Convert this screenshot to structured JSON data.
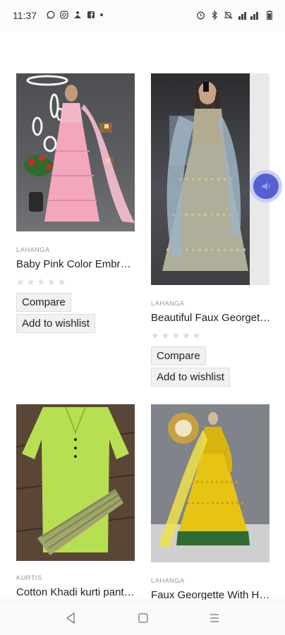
{
  "status_bar": {
    "time": "11:37",
    "left_icons": [
      "whatsapp-icon",
      "instagram-icon",
      "share-icon",
      "facebook-icon",
      "dot-icon"
    ],
    "right_icons": [
      "alarm-icon",
      "bluetooth-icon",
      "mute-icon",
      "signal-icon",
      "battery-icon"
    ]
  },
  "products": [
    {
      "category": "LAHANGA",
      "name": "Baby Pink Color Embroidered Lehenga",
      "compare_label": "Compare",
      "wishlist_label": "Add to wishlist",
      "rating": 0,
      "image": "pink-lehenga-image"
    },
    {
      "category": "LAHANGA",
      "name": "Beautiful Faux Georgette Lehenga",
      "compare_label": "Compare",
      "wishlist_label": "Add to wishlist",
      "rating": 0,
      "image": "grey-lehenga-image"
    },
    {
      "category": "KURTIS",
      "name": "Cotton Khadi kurti pant set",
      "image": "green-kurti-image"
    },
    {
      "category": "LAHANGA",
      "name": "Faux Georgette With Heavy Work",
      "image": "yellow-gown-image"
    }
  ],
  "floating_button": {
    "icon": "audio-icon"
  },
  "nav": {
    "icons": [
      "back-icon",
      "home-icon",
      "menu-icon"
    ]
  },
  "colors": {
    "accent": "#5561d3",
    "background": "#ffffff"
  }
}
